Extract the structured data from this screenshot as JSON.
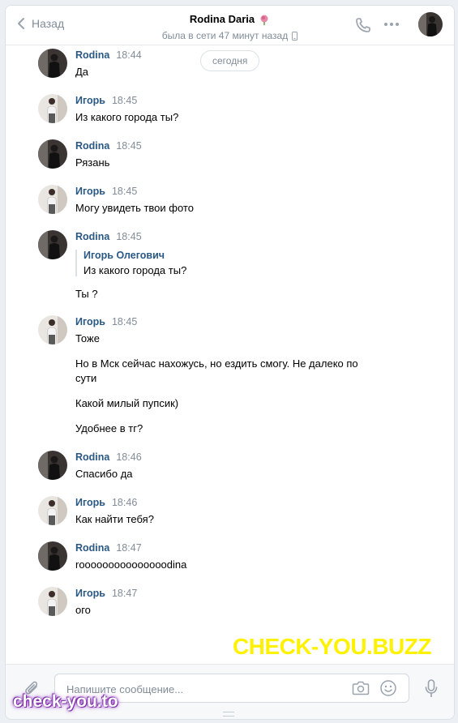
{
  "header": {
    "back_label": "Назад",
    "title": "Rodina Daria",
    "title_emoji": "rose-emoji",
    "status": "была в сети 47 минут назад"
  },
  "date_separator": "сегодня",
  "messages": [
    {
      "author": "Rodina",
      "time": "18:44",
      "texts": [
        "Да"
      ],
      "avatar": "dark"
    },
    {
      "author": "Игорь",
      "time": "18:45",
      "texts": [
        "Из какого города ты?"
      ],
      "avatar": "light"
    },
    {
      "author": "Rodina",
      "time": "18:45",
      "texts": [
        "Рязань"
      ],
      "avatar": "dark"
    },
    {
      "author": "Игорь",
      "time": "18:45",
      "texts": [
        "Могу увидеть твои фото"
      ],
      "avatar": "light"
    },
    {
      "author": "Rodina",
      "time": "18:45",
      "reply": {
        "author": "Игорь Олегович",
        "text": "Из какого города ты?"
      },
      "texts": [
        "Ты ?"
      ],
      "avatar": "dark"
    },
    {
      "author": "Игорь",
      "time": "18:45",
      "texts": [
        "Тоже",
        "Но в Мск сейчас нахожусь, но ездить смогу. Не далеко по сути",
        "Какой милый пупсик)",
        "Удобнее в тг?"
      ],
      "avatar": "light"
    },
    {
      "author": "Rodina",
      "time": "18:46",
      "texts": [
        "Спасибо да"
      ],
      "avatar": "dark"
    },
    {
      "author": "Игорь",
      "time": "18:46",
      "texts": [
        "Как найти тебя?"
      ],
      "avatar": "light"
    },
    {
      "author": "Rodina",
      "time": "18:47",
      "texts": [
        "rooooooooooooooodina"
      ],
      "avatar": "dark"
    },
    {
      "author": "Игорь",
      "time": "18:47",
      "texts": [
        "ого"
      ],
      "avatar": "light"
    }
  ],
  "composer": {
    "placeholder": "Напишите сообщение..."
  },
  "watermarks": {
    "big": "CHECK-YOU.BUZZ",
    "small": "check-you.to"
  },
  "colors": {
    "accent": "#2a5885",
    "muted": "#818c99",
    "watermark_yellow": "#fff200"
  }
}
